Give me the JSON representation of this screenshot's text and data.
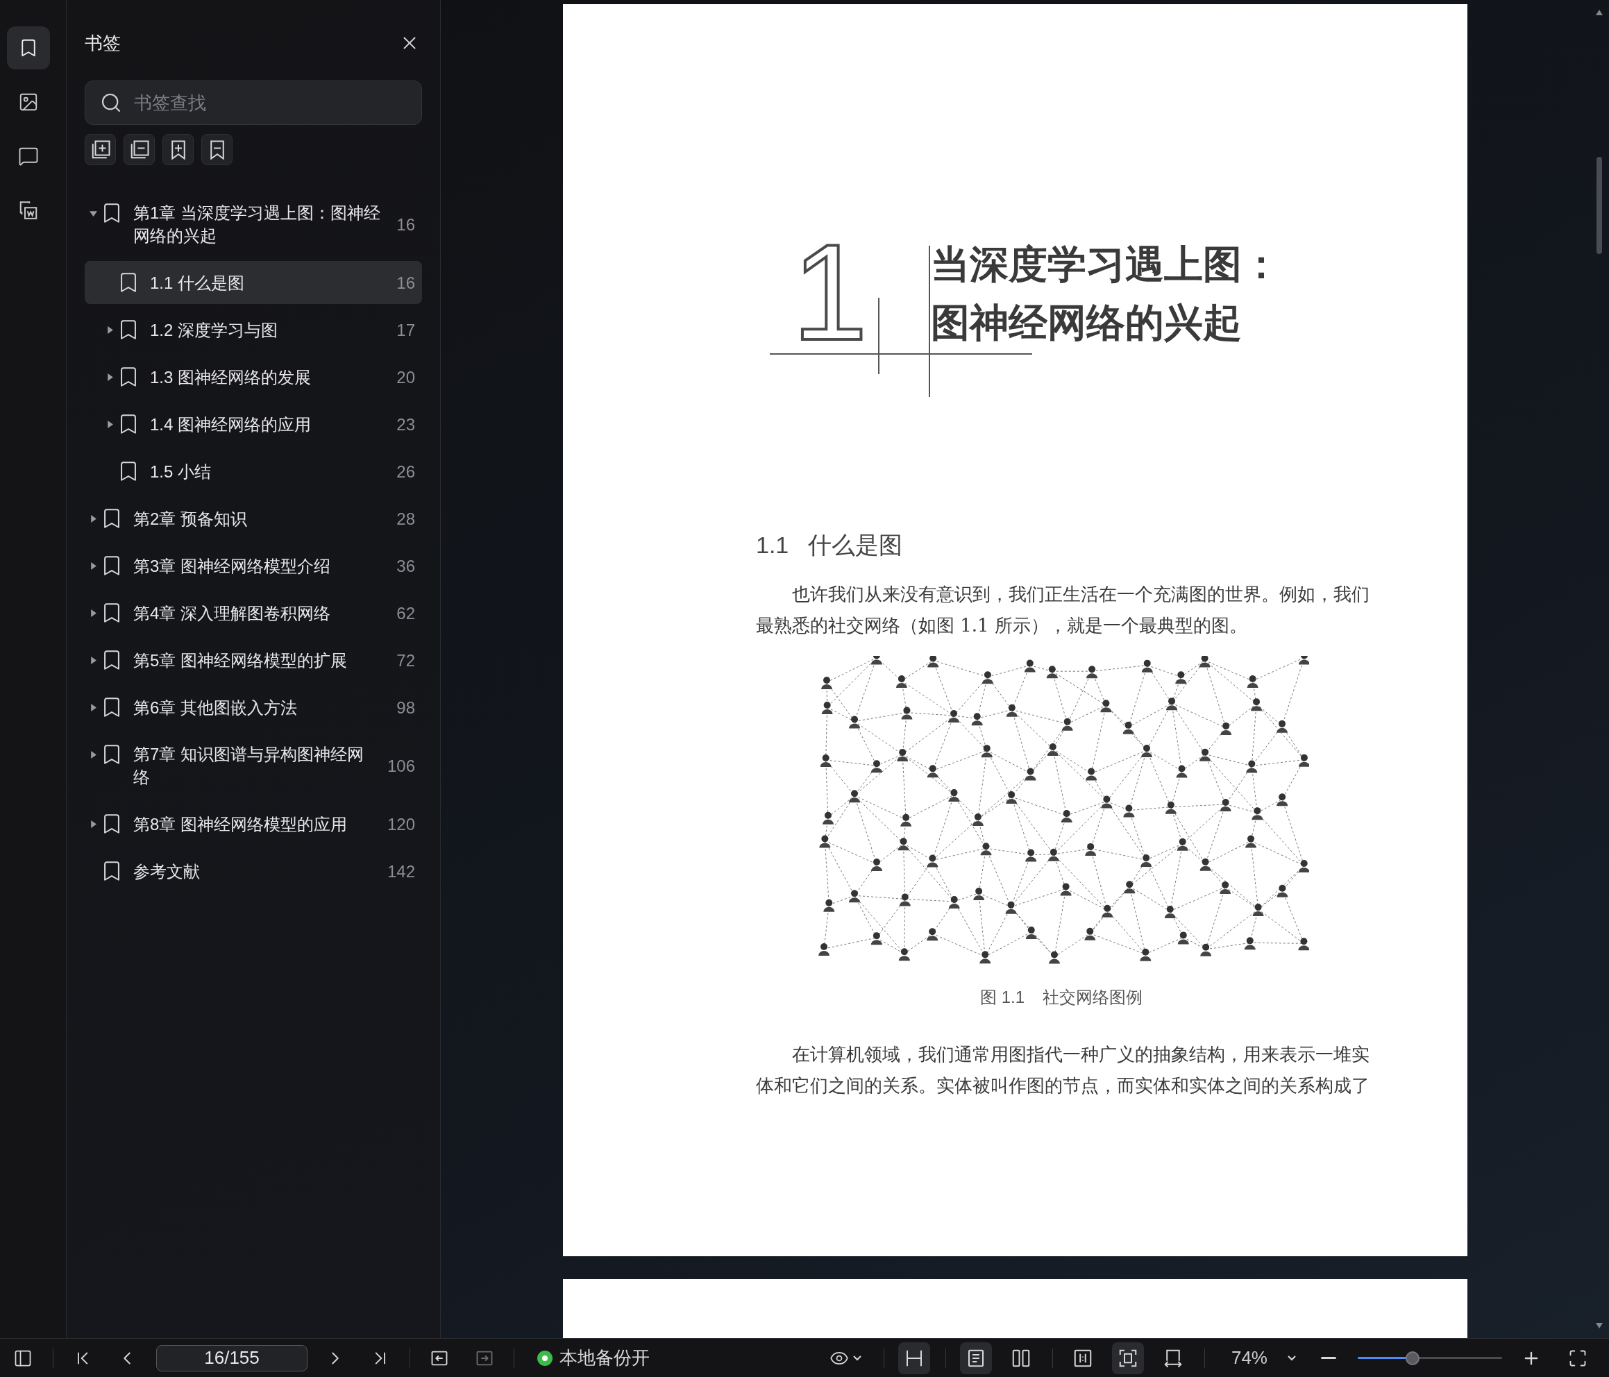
{
  "rail": [
    {
      "kind": "bookmarks",
      "selected": true
    },
    {
      "kind": "thumbnails",
      "selected": false
    },
    {
      "kind": "comments",
      "selected": false
    },
    {
      "kind": "convert",
      "selected": false
    }
  ],
  "bookmark_panel": {
    "title": "书签",
    "search": {
      "placeholder": "书签查找"
    },
    "tools": [
      {
        "kind": "expand-all"
      },
      {
        "kind": "collapse-all"
      },
      {
        "kind": "add"
      },
      {
        "kind": "remove"
      }
    ],
    "items": [
      {
        "title": "第1章 当深度学习遇上图：图神经网络的兴起",
        "page": "16",
        "kind": "branch",
        "expanded": true,
        "selected": false,
        "children": [
          {
            "title": "1.1 什么是图",
            "page": "16",
            "kind": "leaf",
            "selected": true
          },
          {
            "title": "1.2 深度学习与图",
            "page": "17",
            "kind": "branch",
            "expanded": false,
            "selected": false
          },
          {
            "title": "1.3 图神经网络的发展",
            "page": "20",
            "kind": "branch",
            "expanded": false,
            "selected": false
          },
          {
            "title": "1.4 图神经网络的应用",
            "page": "23",
            "kind": "branch",
            "expanded": false,
            "selected": false
          },
          {
            "title": "1.5 小结",
            "page": "26",
            "kind": "leaf",
            "selected": false
          }
        ]
      },
      {
        "title": "第2章 预备知识",
        "page": "28",
        "kind": "branch",
        "expanded": false,
        "selected": false
      },
      {
        "title": "第3章 图神经网络模型介绍",
        "page": "36",
        "kind": "branch",
        "expanded": false,
        "selected": false
      },
      {
        "title": "第4章 深入理解图卷积网络",
        "page": "62",
        "kind": "branch",
        "expanded": false,
        "selected": false
      },
      {
        "title": "第5章 图神经网络模型的扩展",
        "page": "72",
        "kind": "branch",
        "expanded": false,
        "selected": false
      },
      {
        "title": "第6章 其他图嵌入方法",
        "page": "98",
        "kind": "branch",
        "expanded": false,
        "selected": false
      },
      {
        "title": "第7章 知识图谱与异构图神经网络",
        "page": "106",
        "kind": "branch",
        "expanded": false,
        "selected": false
      },
      {
        "title": "第8章 图神经网络模型的应用",
        "page": "120",
        "kind": "branch",
        "expanded": false,
        "selected": false
      },
      {
        "title": "参考文献",
        "page": "142",
        "kind": "leaf",
        "selected": false
      }
    ]
  },
  "document": {
    "page": {
      "chapter_number": "1",
      "chapter_title": [
        "当深度学习遇上图：",
        "图神经网络的兴起"
      ],
      "section": {
        "number": "1.1",
        "title": "什么是图"
      },
      "paragraph_1": [
        "也许我们从来没有意识到，我们正生活在一个充满图的世界。例如，我们",
        "最熟悉的社交网络（如图 1.1 所示），就是一个最典型的图。"
      ],
      "figure_caption": {
        "label": "图 1.1",
        "title": "社交网络图例"
      },
      "paragraph_2": [
        "在计算机领域，我们通常用图指代一种广义的抽象结构，用来表示一堆实",
        "体和它们之间的关系。实体被叫作图的节点，而实体和实体之间的关系构成了"
      ]
    }
  },
  "toolbar": {
    "page_field": {
      "value": "16/155"
    },
    "history": [
      {
        "kind": "back",
        "disabled": false
      },
      {
        "kind": "forward",
        "disabled": true
      }
    ],
    "backup": {
      "label": "本地备份开",
      "on": true
    },
    "view_groups": [
      [
        {
          "kind": "continuous",
          "selected": true
        }
      ],
      [
        {
          "kind": "single",
          "selected": true
        },
        {
          "kind": "double",
          "selected": false
        }
      ],
      [
        {
          "kind": "fit-width",
          "selected": false
        },
        {
          "kind": "fit-page",
          "selected": true
        },
        {
          "kind": "page-width",
          "selected": false
        }
      ]
    ],
    "zoom": {
      "value": "74%",
      "level": 0.38
    }
  }
}
